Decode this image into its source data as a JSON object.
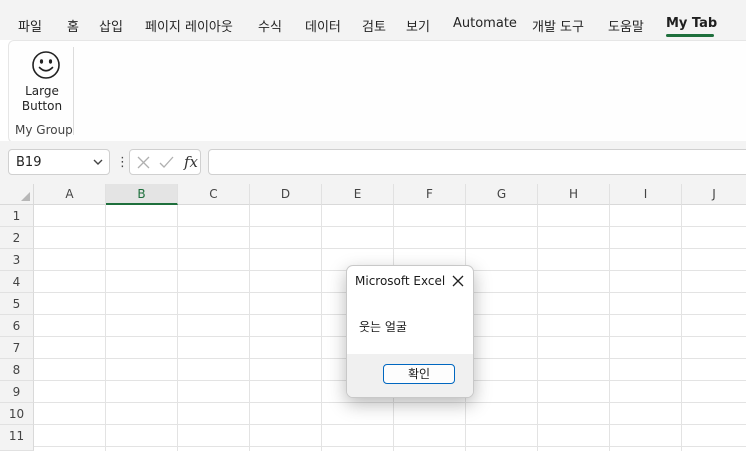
{
  "menu": {
    "tabs": [
      "파일",
      "홈",
      "삽입",
      "페이지 레이아웃",
      "수식",
      "데이터",
      "검토",
      "보기",
      "Automate",
      "개발 도구",
      "도움말",
      "My Tab"
    ],
    "active_tab": "My Tab"
  },
  "ribbon": {
    "button": {
      "label_line1": "Large",
      "label_line2": "Button",
      "icon": "smiley-face-icon"
    },
    "group_label": "My Group"
  },
  "formula_bar": {
    "name_box": "B19",
    "fx_label": "fx",
    "formula_value": ""
  },
  "grid": {
    "columns": [
      "A",
      "B",
      "C",
      "D",
      "E",
      "F",
      "G",
      "H",
      "I",
      "J"
    ],
    "selected_column": "B",
    "rows": [
      "1",
      "2",
      "3",
      "4",
      "5",
      "6",
      "7",
      "8",
      "9",
      "10",
      "11"
    ]
  },
  "dialog": {
    "title": "Microsoft Excel",
    "message": "웃는 얼굴",
    "ok_label": "확인"
  },
  "colors": {
    "accent_green": "#1e6f3c",
    "dialog_button_border": "#0067c0"
  }
}
